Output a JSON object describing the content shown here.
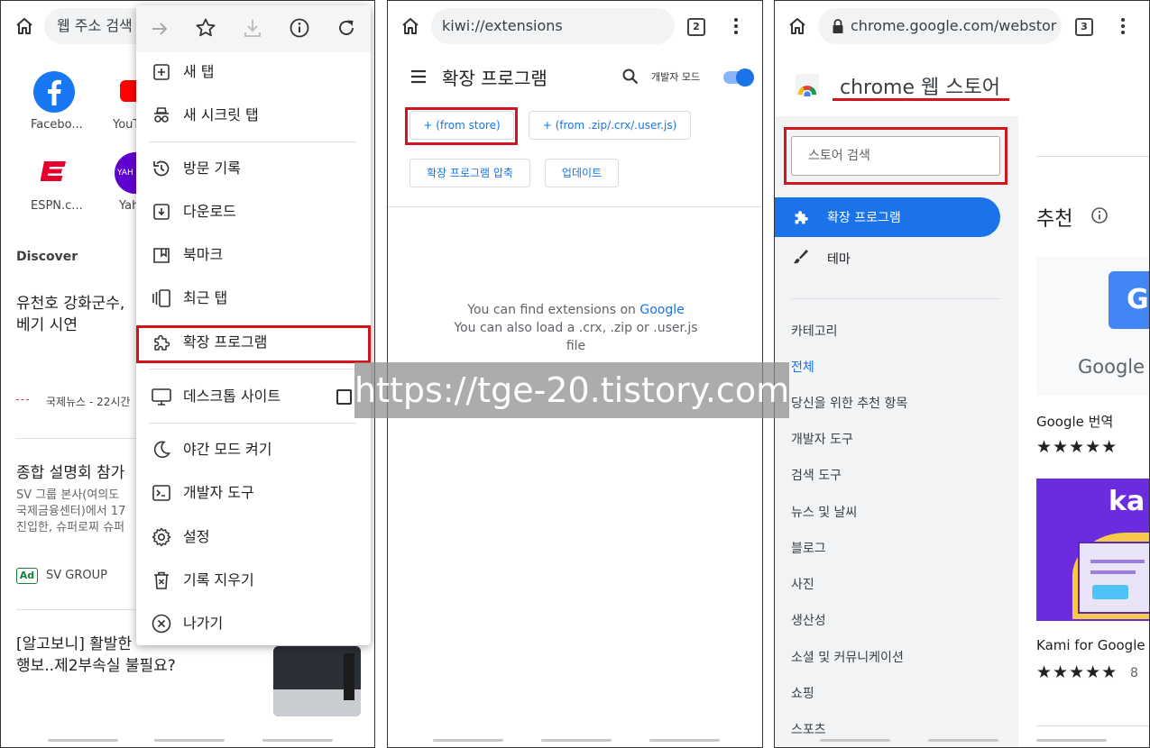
{
  "panel1": {
    "address_text": "웹 주소 검색",
    "tiles": [
      {
        "label": "Facebo..."
      },
      {
        "label": "YouT"
      },
      {
        "label": "ESPN.c..."
      },
      {
        "label": "Yah"
      }
    ],
    "yahoo_logo": "YAH",
    "discover": "Discover",
    "news1": {
      "title_line1": "유천호 강화군수,",
      "title_line2": "베기 시연",
      "source": "국제뉴스 - 22시간"
    },
    "news2": {
      "title": "종합 설명회 참가",
      "desc_line1": "SV 그룹 본사(여의도",
      "desc_line2": "국제금융센터)에서 17",
      "desc_line3": "진입한, 슈퍼로찌 슈퍼",
      "ad_badge": "Ad",
      "advertiser": "SV GROUP"
    },
    "news3": {
      "title_line1": "[알고보니] 활발한",
      "title_line2": "행보..제2부속실 불필요?"
    },
    "menu": {
      "items": [
        {
          "label": "새 탭"
        },
        {
          "label": "새 시크릿 탭"
        },
        {
          "label": "방문 기록"
        },
        {
          "label": "다운로드"
        },
        {
          "label": "북마크"
        },
        {
          "label": "최근 탭"
        },
        {
          "label": "확장 프로그램"
        },
        {
          "label": "데스크톱 사이트"
        },
        {
          "label": "야간 모드 켜기"
        },
        {
          "label": "개발자 도구"
        },
        {
          "label": "설정"
        },
        {
          "label": "기록 지우기"
        },
        {
          "label": "나가기"
        }
      ]
    }
  },
  "panel2": {
    "address_text": "kiwi://extensions",
    "tab_count": "2",
    "title": "확장 프로그램",
    "dev_mode_label": "개발자 모드",
    "dev_mode_on": true,
    "buttons": {
      "from_store": "+ (from store)",
      "from_zip": "+ (from .zip/.crx/.user.js)",
      "pack": "확장 프로그램 압축",
      "update": "업데이트"
    },
    "message": {
      "line1_prefix": "You can find extensions on ",
      "line1_link": "Google",
      "line2": "You can also load a .crx, .zip or .user.js",
      "line3": "file"
    }
  },
  "panel3": {
    "address_text": "chrome.google.com/webstor",
    "tab_count": "3",
    "store_title": "chrome 웹 스토어",
    "search_placeholder": "스토어 검색",
    "nav": {
      "extensions": "확장 프로그램",
      "themes": "테마"
    },
    "categories_heading": "카테고리",
    "categories": [
      "전체",
      "당신을 위한 추천 항목",
      "개발자 도구",
      "검색 도구",
      "뉴스 및 날씨",
      "블로그",
      "사진",
      "생산성",
      "소셜 및 커뮤니케이션",
      "쇼핑",
      "스포츠"
    ],
    "recommended": "추천",
    "card1": {
      "name": "Google 번역",
      "logo_text": "Google T",
      "stars": "★★★★★",
      "rating": 4.5
    },
    "card2": {
      "name": "Kami for Google",
      "logo_text": "ka",
      "stars": "★★★★★",
      "rating": 4.5,
      "count_partial": "8"
    }
  },
  "watermark": "https://tge-20.tistory.com",
  "colors": {
    "highlight_red": "#d4141b",
    "accent_blue": "#1a73e8",
    "facebook_blue": "#1877f2",
    "espn_red": "#e4002b",
    "yahoo_purple": "#6001d2",
    "kami_purple": "#6b2cde"
  }
}
